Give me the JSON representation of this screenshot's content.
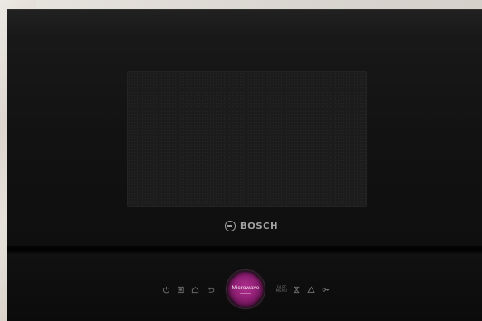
{
  "brand": {
    "name": "BOSCH",
    "logo_icon": "bosch-logo-icon"
  },
  "controls": {
    "icons": [
      "power-icon",
      "menu-icon",
      "home-icon",
      "back-icon",
      "fast-preheat-icon",
      "timer-icon",
      "alert-icon",
      "lock-icon"
    ],
    "fast_label": "FAST\nMENU"
  },
  "dial": {
    "label": "Microwave",
    "color": "#9b2581"
  }
}
